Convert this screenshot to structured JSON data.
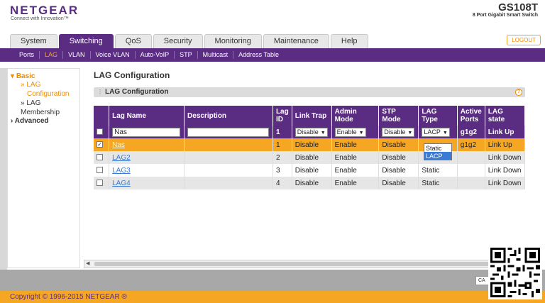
{
  "header": {
    "logo": "NETGEAR",
    "logo_tagline": "Connect with Innovation™",
    "product_name": "GS108T",
    "product_subtitle": "8 Port Gigabit Smart Switch",
    "logout_label": "LOGOUT"
  },
  "tabs": [
    {
      "label": "System"
    },
    {
      "label": "Switching"
    },
    {
      "label": "QoS"
    },
    {
      "label": "Security"
    },
    {
      "label": "Monitoring"
    },
    {
      "label": "Maintenance"
    },
    {
      "label": "Help"
    }
  ],
  "subnav": [
    {
      "label": "Ports"
    },
    {
      "label": "LAG"
    },
    {
      "label": "VLAN"
    },
    {
      "label": "Voice VLAN"
    },
    {
      "label": "Auto-VoIP"
    },
    {
      "label": "STP"
    },
    {
      "label": "Multicast"
    },
    {
      "label": "Address Table"
    }
  ],
  "leftnav": {
    "basic": "Basic",
    "lag_configuration_a": "» LAG",
    "lag_configuration_b": "Configuration",
    "lag_membership": "» LAG Membership",
    "advanced": "Advanced"
  },
  "page": {
    "title": "LAG Configuration",
    "section_title": "LAG Configuration",
    "help": "?"
  },
  "table": {
    "headers": [
      "Lag Name",
      "Description",
      "Lag ID",
      "Link Trap",
      "Admin Mode",
      "STP Mode",
      "LAG Type",
      "Active Ports",
      "LAG state"
    ],
    "edit_row": {
      "lag_name": "Nas",
      "description": "",
      "lag_id": "1",
      "link_trap": "Disable",
      "admin_mode": "Enable",
      "stp_mode": "Disable",
      "lag_type": "LACP",
      "active_ports": "g1g2",
      "lag_state": "Link Up"
    },
    "rows": [
      {
        "name": "Nas",
        "description": "",
        "lag_id": "1",
        "link_trap": "Disable",
        "admin_mode": "Enable",
        "stp_mode": "Disable",
        "lag_type": "",
        "active_ports": "g1g2",
        "lag_state": "Link Up",
        "checked": true
      },
      {
        "name": "LAG2",
        "description": "",
        "lag_id": "2",
        "link_trap": "Disable",
        "admin_mode": "Enable",
        "stp_mode": "Disable",
        "lag_type": "",
        "active_ports": "",
        "lag_state": "Link Down",
        "checked": false
      },
      {
        "name": "LAG3",
        "description": "",
        "lag_id": "3",
        "link_trap": "Disable",
        "admin_mode": "Enable",
        "stp_mode": "Disable",
        "lag_type": "Static",
        "active_ports": "",
        "lag_state": "Link Down",
        "checked": false
      },
      {
        "name": "LAG4",
        "description": "",
        "lag_id": "4",
        "link_trap": "Disable",
        "admin_mode": "Enable",
        "stp_mode": "Disable",
        "lag_type": "Static",
        "active_ports": "",
        "lag_state": "Link Down",
        "checked": false
      }
    ]
  },
  "lag_type_dropdown": {
    "options": [
      "Static",
      "LACP"
    ],
    "highlighted": "LACP"
  },
  "footer": {
    "copyright": "Copyright © 1996-2015 NETGEAR ®",
    "cancel_label": "CA"
  },
  "colors": {
    "brand_purple": "#5a2d82",
    "accent_orange": "#f5a623",
    "link_blue": "#3a7bd5"
  }
}
